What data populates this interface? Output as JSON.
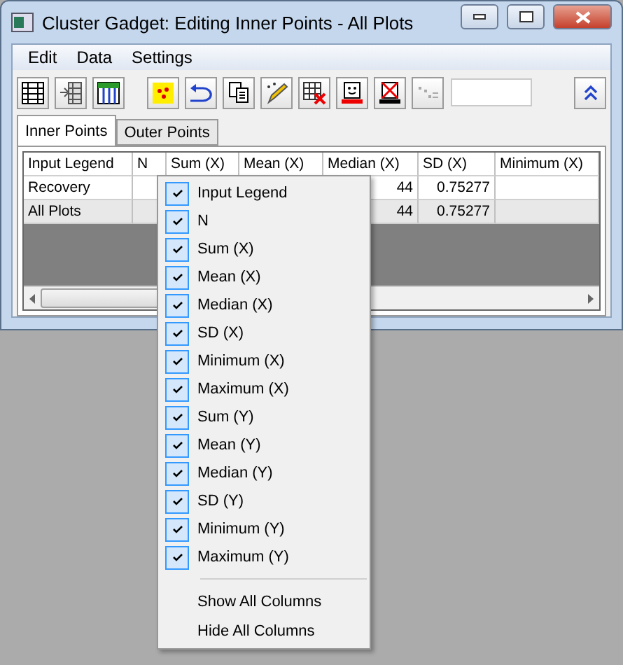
{
  "window": {
    "title": "Cluster Gadget: Editing Inner Points - All Plots"
  },
  "menu_bar": [
    "Edit",
    "Data",
    "Settings"
  ],
  "tabs": [
    {
      "label": "Inner Points",
      "selected": true
    },
    {
      "label": "Outer Points",
      "selected": false
    }
  ],
  "table": {
    "columns": [
      "Input Legend",
      "N",
      "Sum (X)",
      "Mean (X)",
      "Median (X)",
      "SD (X)",
      "Minimum (X)"
    ],
    "rows": [
      {
        "cells": [
          "Recovery",
          "",
          "",
          "",
          "44",
          "0.75277",
          ""
        ],
        "selected": false
      },
      {
        "cells": [
          "All Plots",
          "",
          "",
          "",
          "44",
          "0.75277",
          ""
        ],
        "selected": true
      }
    ]
  },
  "context_menu": {
    "items": [
      {
        "label": "Input Legend",
        "checked": true
      },
      {
        "label": "N",
        "checked": true
      },
      {
        "label": "Sum (X)",
        "checked": true
      },
      {
        "label": "Mean (X)",
        "checked": true
      },
      {
        "label": "Median (X)",
        "checked": true
      },
      {
        "label": "SD (X)",
        "checked": true
      },
      {
        "label": "Minimum (X)",
        "checked": true
      },
      {
        "label": "Maximum (X)",
        "checked": true
      },
      {
        "label": "Sum (Y)",
        "checked": true
      },
      {
        "label": "Mean (Y)",
        "checked": true
      },
      {
        "label": "Median (Y)",
        "checked": true
      },
      {
        "label": "SD (Y)",
        "checked": true
      },
      {
        "label": "Minimum (Y)",
        "checked": true
      },
      {
        "label": "Maximum (Y)",
        "checked": true
      }
    ],
    "commands": [
      "Show All Columns",
      "Hide All Columns"
    ]
  }
}
